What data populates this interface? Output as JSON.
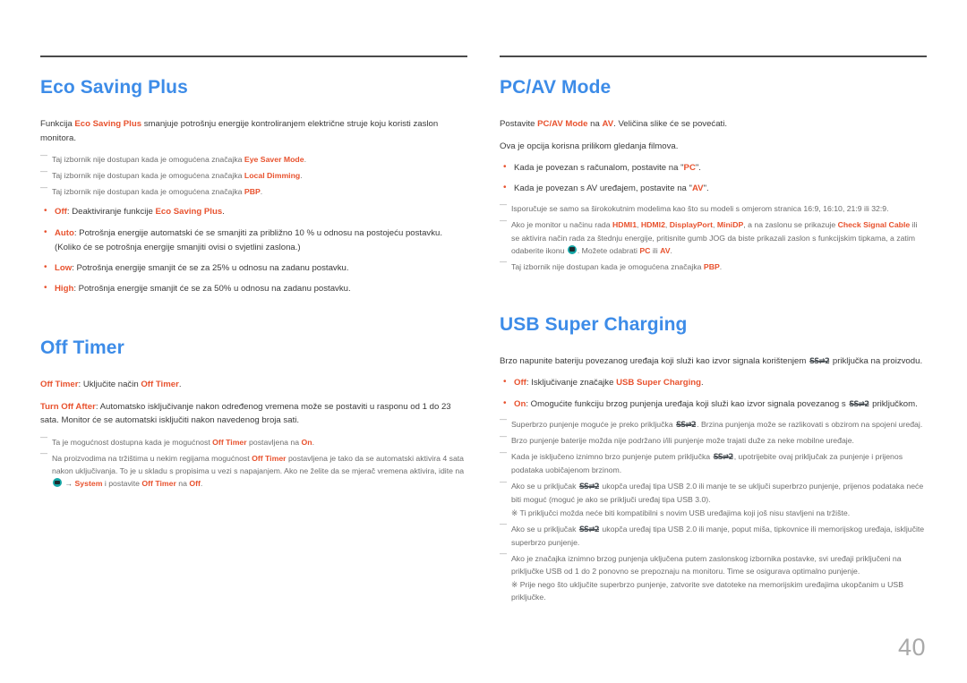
{
  "colors": {
    "heading": "#3d8ce8",
    "accent": "#e8522e",
    "body": "#3a3a3a",
    "note": "#6d6d6d",
    "rule": "#4a4a4a",
    "page_number": "#a9a9a9",
    "jog_icon": "#14a5a5"
  },
  "page_number": "40",
  "left_column": {
    "eco_saving_plus": {
      "title": "Eco Saving Plus",
      "intro": {
        "pre": "Funkcija ",
        "accent1": "Eco Saving Plus",
        "post": " smanjuje potrošnju energije kontroliranjem električne struje koju koristi zaslon monitora."
      },
      "notes": [
        {
          "pre": "Taj izbornik nije dostupan kada je omogućena značajka ",
          "accent": "Eye Saver Mode",
          "post": "."
        },
        {
          "pre": "Taj izbornik nije dostupan kada je omogućena značajka ",
          "accent": "Local Dimming",
          "post": "."
        },
        {
          "pre": "Taj izbornik nije dostupan kada je omogućena značajka ",
          "accent": "PBP",
          "post": "."
        }
      ],
      "bullets": [
        {
          "label": "Off",
          "pre": ": Deaktiviranje funkcije ",
          "accent2": "Eco Saving Plus",
          "post": "."
        },
        {
          "label": "Auto",
          "pre": ": Potrošnja energije automatski će se smanjiti za približno 10 % u odnosu na postojeću postavku. (Koliko će se potrošnja energije smanjiti ovisi o svjetlini zaslona.)",
          "accent2": "",
          "post": ""
        },
        {
          "label": "Low",
          "pre": ": Potrošnja energije smanjit će se za 25% u odnosu na zadanu postavku.",
          "accent2": "",
          "post": ""
        },
        {
          "label": "High",
          "pre": ": Potrošnja energije smanjit će se za 50% u odnosu na zadanu postavku.",
          "accent2": "",
          "post": ""
        }
      ]
    },
    "off_timer": {
      "title": "Off Timer",
      "para1": {
        "accent1": "Off Timer",
        "mid": ": Uključite način ",
        "accent2": "Off Timer",
        "post": "."
      },
      "para2": {
        "accent1": "Turn Off After",
        "post": ": Automatsko isključivanje nakon određenog vremena može se postaviti u rasponu od 1 do 23 sata. Monitor će se automatski isključiti nakon navedenog broja sati."
      },
      "note1": {
        "pre": "Ta je mogućnost dostupna kada je mogućnost ",
        "accent1": "Off Timer",
        "mid": " postavljena na ",
        "accent2": "On",
        "post": "."
      },
      "note2": {
        "pre": "Na proizvodima na tržištima u nekim regijama mogućnost ",
        "accent1": "Off Timer",
        "mid": " postavljena je tako da se automatski aktivira 4 sata nakon uključivanja. To je u skladu s propisima u vezi s napajanjem. Ako ne želite da se mjerač vremena aktivira, idite na ",
        "icon": "display-menu-icon",
        "arrow": " → ",
        "accent2": "System",
        "mid2": " i postavite ",
        "accent3": "Off Timer",
        "mid3": " na ",
        "accent4": "Off",
        "post": "."
      }
    }
  },
  "right_column": {
    "pc_av_mode": {
      "title": "PC/AV Mode",
      "para1": {
        "pre": "Postavite ",
        "accent1": "PC/AV Mode",
        "mid": " na ",
        "accent2": "AV",
        "post": ". Veličina slike će se povećati."
      },
      "para2": "Ova je opcija korisna prilikom gledanja filmova.",
      "bullets": [
        {
          "pre": "Kada je povezan s računalom, postavite na \"",
          "accent": "PC",
          "post": "\"."
        },
        {
          "pre": "Kada je povezan s AV uređajem, postavite na \"",
          "accent": "AV",
          "post": "\"."
        }
      ],
      "notes": [
        {
          "text": "Isporučuje se samo sa širokokutnim modelima kao što su modeli s omjerom stranica 16:9, 16:10, 21:9 ili 32:9."
        },
        {
          "pre": "Ako je monitor u načinu rada ",
          "accent1": "HDMI1",
          "sep1": ", ",
          "accent2": "HDMI2",
          "sep2": ", ",
          "accent3": "DisplayPort",
          "sep3": ", ",
          "accent4": "MiniDP",
          "mid": ", a na zaslonu se prikazuje ",
          "accent5": "Check Signal Cable",
          "mid2": " ili se aktivira način rada za štednju energije, pritisnite gumb JOG da biste prikazali zaslon s funkcijskim tipkama, a zatim odaberite ikonu ",
          "icon": "display-menu-icon",
          "mid3": ". Možete odabrati ",
          "accent6": "PC",
          "mid4": " ili ",
          "accent7": "AV",
          "post": "."
        },
        {
          "pre": "Taj izbornik nije dostupan kada je omogućena značajka ",
          "accent1": "PBP",
          "post": "."
        }
      ]
    },
    "usb_super_charging": {
      "title": "USB Super Charging",
      "intro": {
        "pre": "Brzo napunite bateriju povezanog uređaja koji služi kao izvor signala korištenjem ",
        "usb_symbol": "SS⇄2",
        "post": " priključka na proizvodu."
      },
      "bullets": [
        {
          "label": "Off",
          "pre": ": Isključivanje značajke ",
          "accent2": "USB Super Charging",
          "post": "."
        },
        {
          "label": "On",
          "pre": ": Omogućite funkciju brzog punjenja uređaja koji služi kao izvor signala povezanog s ",
          "usb_symbol": "SS⇄2",
          "post": " priključkom."
        }
      ],
      "notes": [
        {
          "pre": "Superbrzo punjenje moguće je preko priključka ",
          "usb_symbol": "SS⇄2",
          "post": ". Brzina punjenja može se razlikovati s obzirom na spojeni uređaj."
        },
        {
          "pre": "Brzo punjenje baterije možda nije podržano i/ili punjenje može trajati duže za neke mobilne uređaje.",
          "usb_symbol": "",
          "post": ""
        },
        {
          "pre": "Kada je isključeno iznimno brzo punjenje putem priključka ",
          "usb_symbol": "SS⇄2",
          "post": ", upotrijebite ovaj priključak za punjenje i prijenos podataka uobičajenom brzinom."
        },
        {
          "pre": "Ako se u priključak ",
          "usb_symbol": "SS⇄2",
          "post": " ukopča uređaj tipa USB 2.0 ili manje te se uključi superbrzo punjenje, prijenos podataka neće biti moguć (moguć je ako se priključi uređaj tipa USB 3.0).",
          "substar": "Ti priključci možda neće biti kompatibilni s novim USB uređajima koji još nisu stavljeni na tržište."
        },
        {
          "pre": "Ako se u priključak ",
          "usb_symbol": "SS⇄2",
          "post": " ukopča uređaj tipa USB 2.0 ili manje, poput miša, tipkovnice ili memorijskog uređaja, isključite superbrzo punjenje."
        },
        {
          "pre": "Ako je značajka iznimno brzog punjenja uključena putem zaslonskog izbornika postavke, svi uređaji priključeni na priključke USB od 1 do 2 ponovno se prepoznaju na monitoru.  Time se osigurava optimalno punjenje.",
          "usb_symbol": "",
          "post": "",
          "substar": "Prije nego što uključite superbrzo punjenje, zatvorite sve datoteke na memorijskim uređajima ukopčanim u USB priključke."
        }
      ]
    }
  }
}
